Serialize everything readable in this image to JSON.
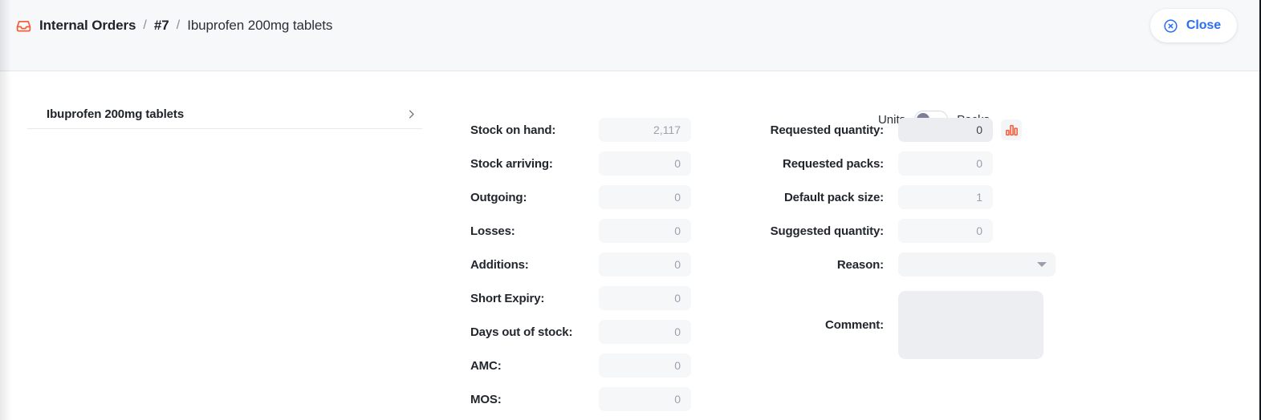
{
  "header": {
    "icon": "inbox-icon",
    "breadcrumb_root": "Internal Orders",
    "separator": "/",
    "breadcrumb_id": "#7",
    "breadcrumb_leaf": "Ibuprofen 200mg tablets",
    "close_label": "Close",
    "close_icon": "close-circle-icon",
    "accent_orange": "#f4603c",
    "accent_blue": "#2a6ef5"
  },
  "item_list": {
    "items": [
      {
        "label": "Ibuprofen 200mg tablets",
        "chevron": "chevron-right-icon"
      }
    ]
  },
  "stock_fields": [
    {
      "label": "Stock on hand:",
      "value": "2,117"
    },
    {
      "label": "Stock arriving:",
      "value": "0"
    },
    {
      "label": "Outgoing:",
      "value": "0"
    },
    {
      "label": "Losses:",
      "value": "0"
    },
    {
      "label": "Additions:",
      "value": "0"
    },
    {
      "label": "Short Expiry:",
      "value": "0"
    },
    {
      "label": "Days out of stock:",
      "value": "0"
    },
    {
      "label": "AMC:",
      "value": "0"
    },
    {
      "label": "MOS:",
      "value": "0"
    }
  ],
  "units_toggle": {
    "left_label": "Units",
    "right_label": "Packs",
    "selected": "Units",
    "knob_color": "#7b7f99"
  },
  "request_fields": [
    {
      "label": "Requested quantity:",
      "value": "0",
      "editable": true,
      "chart_icon": "bar-chart-icon"
    },
    {
      "label": "Requested packs:",
      "value": "0",
      "editable": false
    },
    {
      "label": "Default pack size:",
      "value": "1",
      "editable": false
    },
    {
      "label": "Suggested quantity:",
      "value": "0",
      "editable": false
    }
  ],
  "reason": {
    "label": "Reason:",
    "value": "",
    "placeholder": "",
    "chevron": "chevron-down-icon"
  },
  "comment": {
    "label": "Comment:",
    "value": "",
    "placeholder": ""
  }
}
